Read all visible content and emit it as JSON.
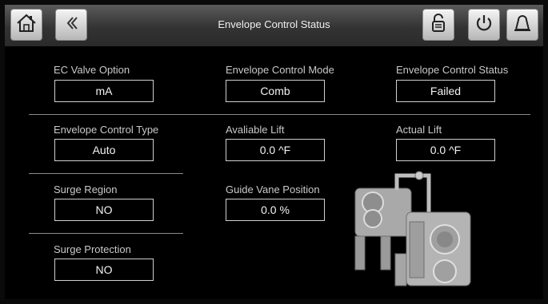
{
  "header": {
    "title": "Envelope Control Status"
  },
  "icons": {
    "home": "home-icon",
    "back": "chevron-left-icon",
    "lock": "lock-icon",
    "power": "power-icon",
    "alarm": "bell-icon"
  },
  "fields": {
    "ec_valve_option": {
      "label": "EC Valve Option",
      "value": "mA"
    },
    "envelope_control_mode": {
      "label": "Envelope Control Mode",
      "value": "Comb"
    },
    "envelope_control_status": {
      "label": "Envelope Control Status",
      "value": "Failed"
    },
    "envelope_control_type": {
      "label": "Envelope Control Type",
      "value": "Auto"
    },
    "available_lift": {
      "label": "Avaliable Lift",
      "value": "0.0 ^F"
    },
    "actual_lift": {
      "label": "Actual Lift",
      "value": "0.0 ^F"
    },
    "surge_region": {
      "label": "Surge Region",
      "value": "NO"
    },
    "guide_vane_position": {
      "label": "Guide Vane Position",
      "value": "0.0 %"
    },
    "surge_protection": {
      "label": "Surge Protection",
      "value": "NO"
    }
  },
  "colors": {
    "background": "#000000",
    "header_top": "#5b5b5b",
    "header_bottom": "#2a2a2a",
    "text": "#d8d8d8",
    "box_border": "#cfcfcf"
  }
}
